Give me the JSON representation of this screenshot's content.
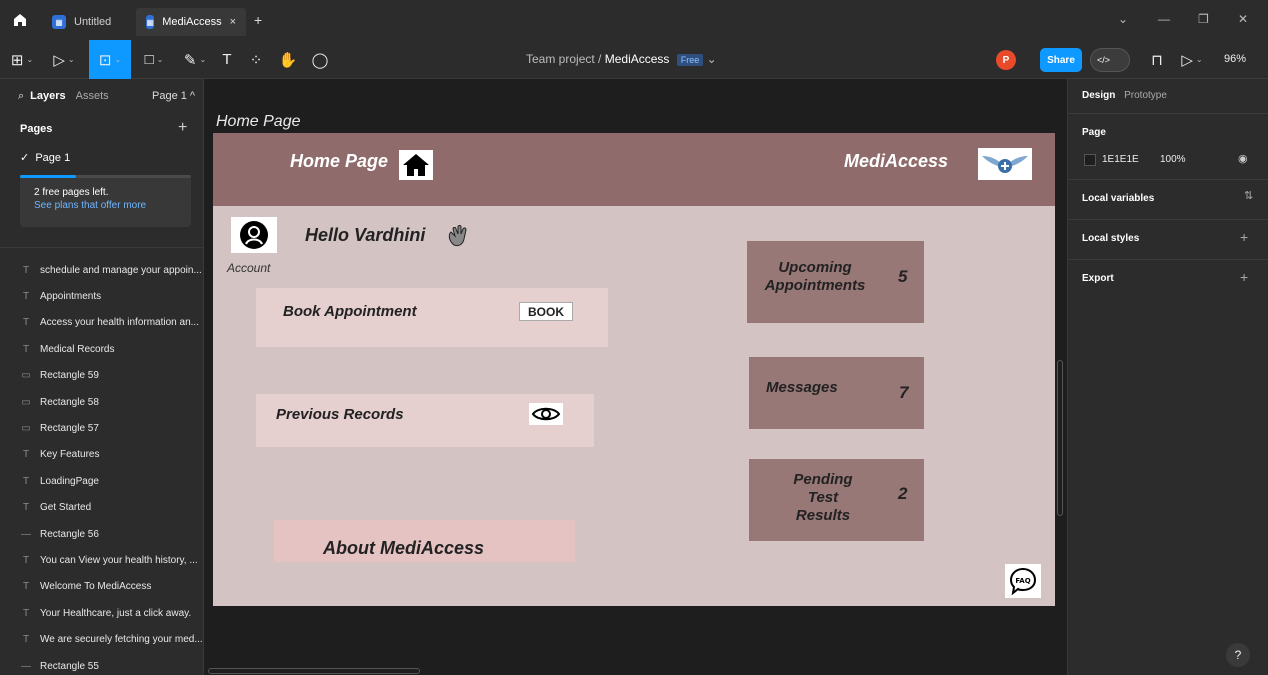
{
  "titlebar": {
    "tabs": [
      {
        "label": "Untitled",
        "active": false
      },
      {
        "label": "MediAccess",
        "active": true
      }
    ],
    "close_glyph": "×",
    "add_glyph": "+",
    "window_controls": [
      "⌄",
      "—",
      "❐",
      "✕"
    ]
  },
  "toolbar": {
    "breadcrumb_team": "Team project",
    "breadcrumb_sep": "/",
    "breadcrumb_file": "MediAccess",
    "plan_badge": "Free",
    "avatar_initial": "P",
    "share_label": "Share",
    "code_label": "</>",
    "zoom_label": "96%",
    "accent_color": "#0d99ff"
  },
  "left_panel": {
    "layers_tab": "Layers",
    "assets_tab": "Assets",
    "page_selector": "Page 1",
    "pages_title": "Pages",
    "current_page": "Page 1",
    "free_pages_text": "2 free pages left.",
    "plans_link": "See plans that offer more",
    "free_pages_progress": 0.33,
    "layers": [
      {
        "type": "text",
        "label": "schedule and manage your appoin..."
      },
      {
        "type": "text",
        "label": "Appointments"
      },
      {
        "type": "text",
        "label": "Access your health information an..."
      },
      {
        "type": "text",
        "label": "Medical Records"
      },
      {
        "type": "rect",
        "label": "Rectangle 59"
      },
      {
        "type": "rect",
        "label": "Rectangle 58"
      },
      {
        "type": "rect",
        "label": "Rectangle 57"
      },
      {
        "type": "text",
        "label": "Key Features"
      },
      {
        "type": "text",
        "label": "LoadingPage"
      },
      {
        "type": "text",
        "label": "Get Started"
      },
      {
        "type": "line",
        "label": "Rectangle 56"
      },
      {
        "type": "text",
        "label": "You can View your health history, ..."
      },
      {
        "type": "text",
        "label": "Welcome To MediAccess"
      },
      {
        "type": "text",
        "label": "Your Healthcare, just a click away."
      },
      {
        "type": "text",
        "label": "We are securely fetching your med..."
      },
      {
        "type": "line",
        "label": "Rectangle 55"
      }
    ]
  },
  "canvas": {
    "frame_label": "Home Page",
    "header_title": "Home Page",
    "brand": "MediAccess",
    "account_label": "Account",
    "greeting": "Hello Vardhini",
    "book_appointment": "Book Appointment",
    "book_button": "BOOK",
    "previous_records": "Previous Records",
    "about": "About MediAccess",
    "stats": [
      {
        "label": "Upcoming Appointments",
        "count": "5"
      },
      {
        "label": "Messages",
        "count": "7"
      },
      {
        "label": "Pending Test Results",
        "count": "2"
      }
    ],
    "faq_label": "FAQ",
    "colors": {
      "header": "#8f6b6b",
      "frame_bg": "#d3c3c3",
      "card": "#e5cfcf",
      "stat_card": "#987777"
    }
  },
  "right_panel": {
    "design_tab": "Design",
    "prototype_tab": "Prototype",
    "page_section": "Page",
    "bg_hex": "1E1E1E",
    "bg_opacity": "100%",
    "local_variables": "Local variables",
    "local_styles": "Local styles",
    "export": "Export"
  }
}
